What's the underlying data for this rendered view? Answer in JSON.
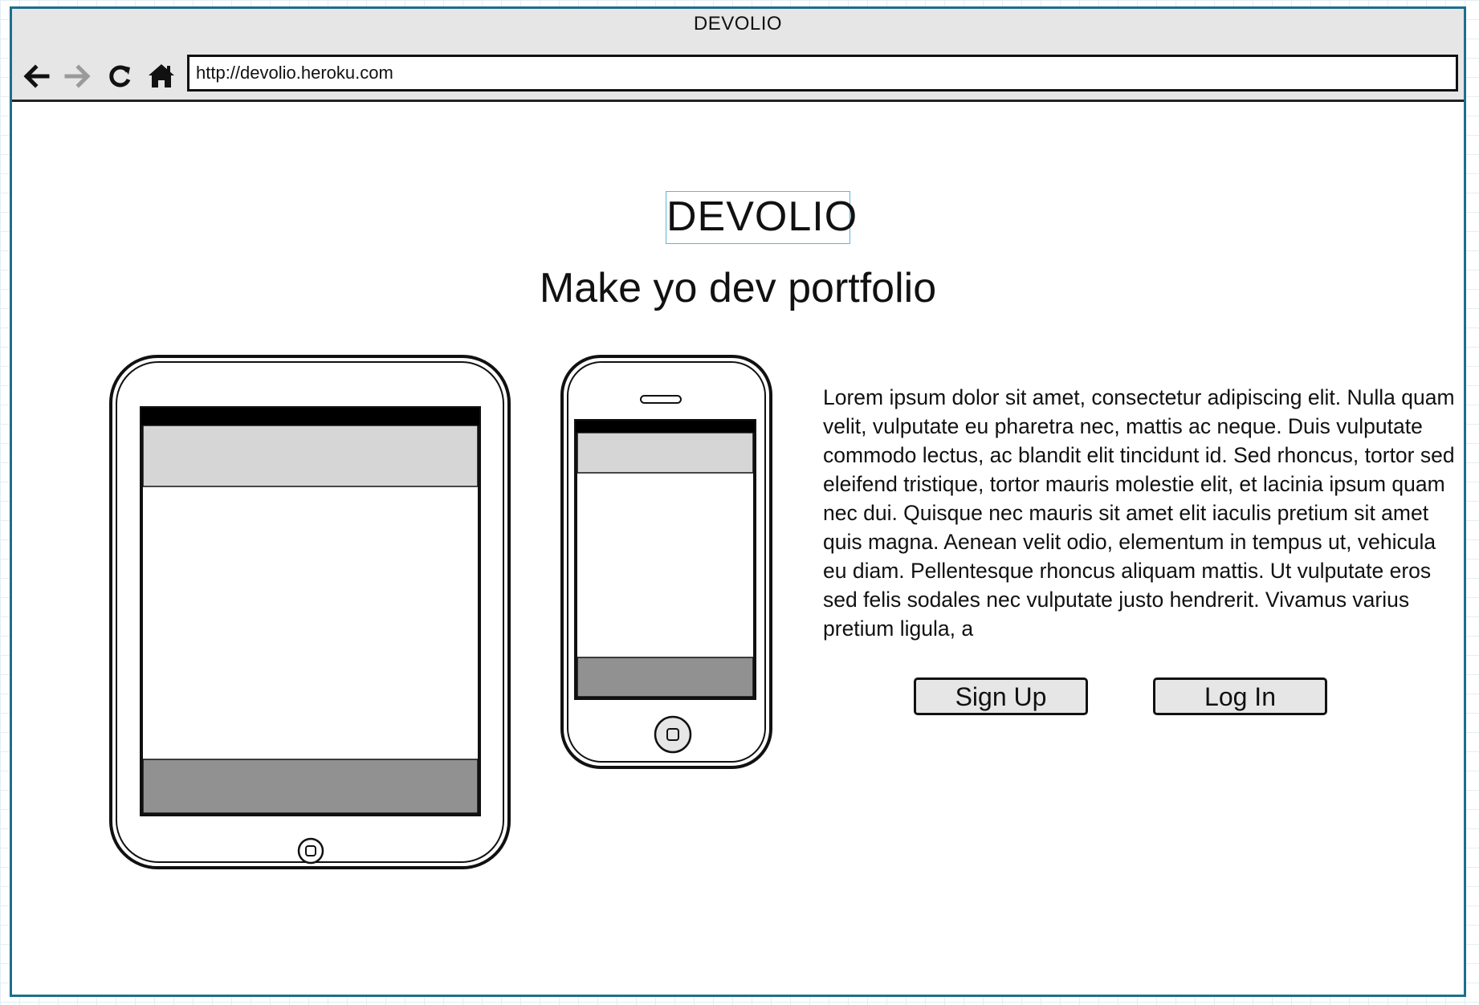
{
  "window": {
    "title": "DEVOLIO"
  },
  "toolbar": {
    "back_icon": "arrow-left-icon",
    "forward_icon": "arrow-right-icon",
    "reload_icon": "reload-icon",
    "home_icon": "home-icon",
    "url": "http://devolio.heroku.com"
  },
  "hero": {
    "title": "DEVOLIO",
    "tagline": "Make yo dev portfolio"
  },
  "content": {
    "paragraph": "Lorem ipsum dolor sit amet, consectetur adipiscing elit. Nulla quam velit, vulputate eu pharetra nec, mattis ac neque. Duis vulputate commodo lectus, ac blandit elit tincidunt id. Sed rhoncus, tortor sed eleifend tristique, tortor mauris molestie elit, et lacinia ipsum quam nec dui. Quisque nec mauris sit amet elit iaculis pretium sit amet quis magna. Aenean velit odio, elementum in tempus ut, vehicula eu diam. Pellentesque rhoncus aliquam mattis. Ut vulputate eros sed felis sodales nec vulputate justo hendrerit. Vivamus varius pretium ligula, a"
  },
  "actions": {
    "signup_label": "Sign Up",
    "login_label": "Log In"
  },
  "devices": {
    "tablet": "tablet-mockup",
    "phone": "phone-mockup"
  },
  "colors": {
    "window_border": "#1d6f8c",
    "titlebar_bg": "#e6e6e6",
    "title_highlight": "#5bb9d9",
    "screen_header": "#d6d6d6",
    "screen_footer": "#919191"
  }
}
